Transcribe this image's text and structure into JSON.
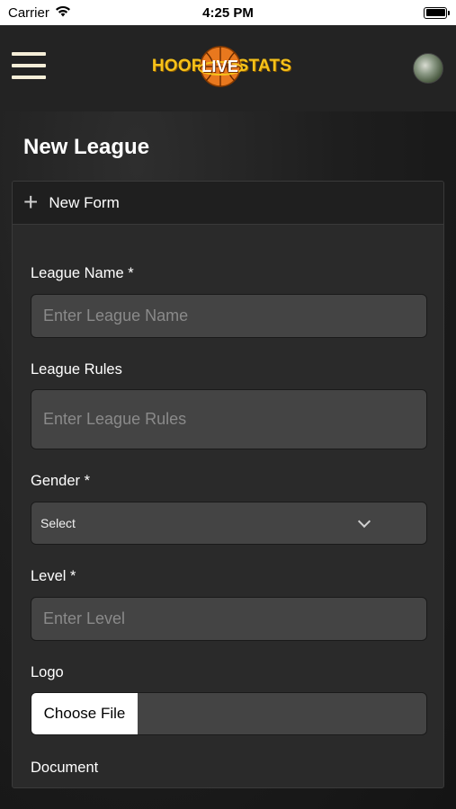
{
  "status_bar": {
    "carrier": "Carrier",
    "time": "4:25 PM"
  },
  "header": {
    "logo_hoop": "HOOP",
    "logo_live": "LIVE",
    "logo_stats": "STATS"
  },
  "page": {
    "title": "New League"
  },
  "form": {
    "header_label": "New Form",
    "league_name": {
      "label": "League Name *",
      "placeholder": "Enter League Name"
    },
    "league_rules": {
      "label": "League Rules",
      "placeholder": "Enter League Rules"
    },
    "gender": {
      "label": "Gender *",
      "selected": "Select"
    },
    "level": {
      "label": "Level *",
      "placeholder": "Enter Level"
    },
    "logo": {
      "label": "Logo",
      "button": "Choose File"
    },
    "document": {
      "label": "Document"
    }
  },
  "colors": {
    "logo_yellow": "#f6c21a",
    "ball_orange": "#e8781e",
    "input_bg": "#444444"
  }
}
